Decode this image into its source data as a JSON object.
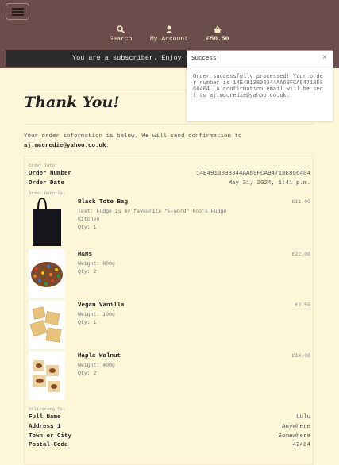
{
  "header": {
    "menu_label": "menu",
    "nav": [
      {
        "icon": "search-icon",
        "label": "Search"
      },
      {
        "icon": "user-icon",
        "label": "My Account"
      },
      {
        "icon": "basket-icon",
        "label": "£50.50"
      }
    ]
  },
  "banner": {
    "text": "You are a subscriber. Enjoy your discount!"
  },
  "toast": {
    "title": "Success!",
    "close": "×",
    "message": "Order successfully processed! Your order number is 14E4913808344AA69FCA94718E866404. A confirmation email will be sent to aj.mccredie@yahoo.co.uk."
  },
  "page": {
    "title": "Thank You!",
    "intro": "Your order information is below. We will send confirmation to",
    "email": "aj.mccredie@yahoo.co.uk",
    "period": "."
  },
  "order": {
    "info_label": "Order Info:",
    "number_label": "Order Number",
    "number": "14E4913808344AA69FCA94718E866404",
    "date_label": "Order Date",
    "date": "May 31, 2024, 1:41 p.m.",
    "details_label": "Order Details:",
    "items": [
      {
        "name": "Black Tote Bag",
        "details": [
          "Text: Fudge is my favourite \"F-word\" Roo's Fudge Kitchen",
          "Qty: 1"
        ],
        "price": "£11.00"
      },
      {
        "name": "M&Ms",
        "details": [
          "Weight: 800g",
          "Qty: 2"
        ],
        "price": "£22.00"
      },
      {
        "name": "Vegan Vanilla",
        "details": [
          "Weight: 100g",
          "Qty: 1"
        ],
        "price": "£3.50"
      },
      {
        "name": "Maple Walnut",
        "details": [
          "Weight: 400g",
          "Qty: 2"
        ],
        "price": "£14.00"
      }
    ]
  },
  "delivery": {
    "label": "Delivering To:",
    "rows": [
      {
        "k": "Full Name",
        "v": "Lulu"
      },
      {
        "k": "Address 1",
        "v": "Anywhere"
      },
      {
        "k": "Town or City",
        "v": "Somewhere"
      },
      {
        "k": "Postal Code",
        "v": "42424"
      }
    ]
  }
}
